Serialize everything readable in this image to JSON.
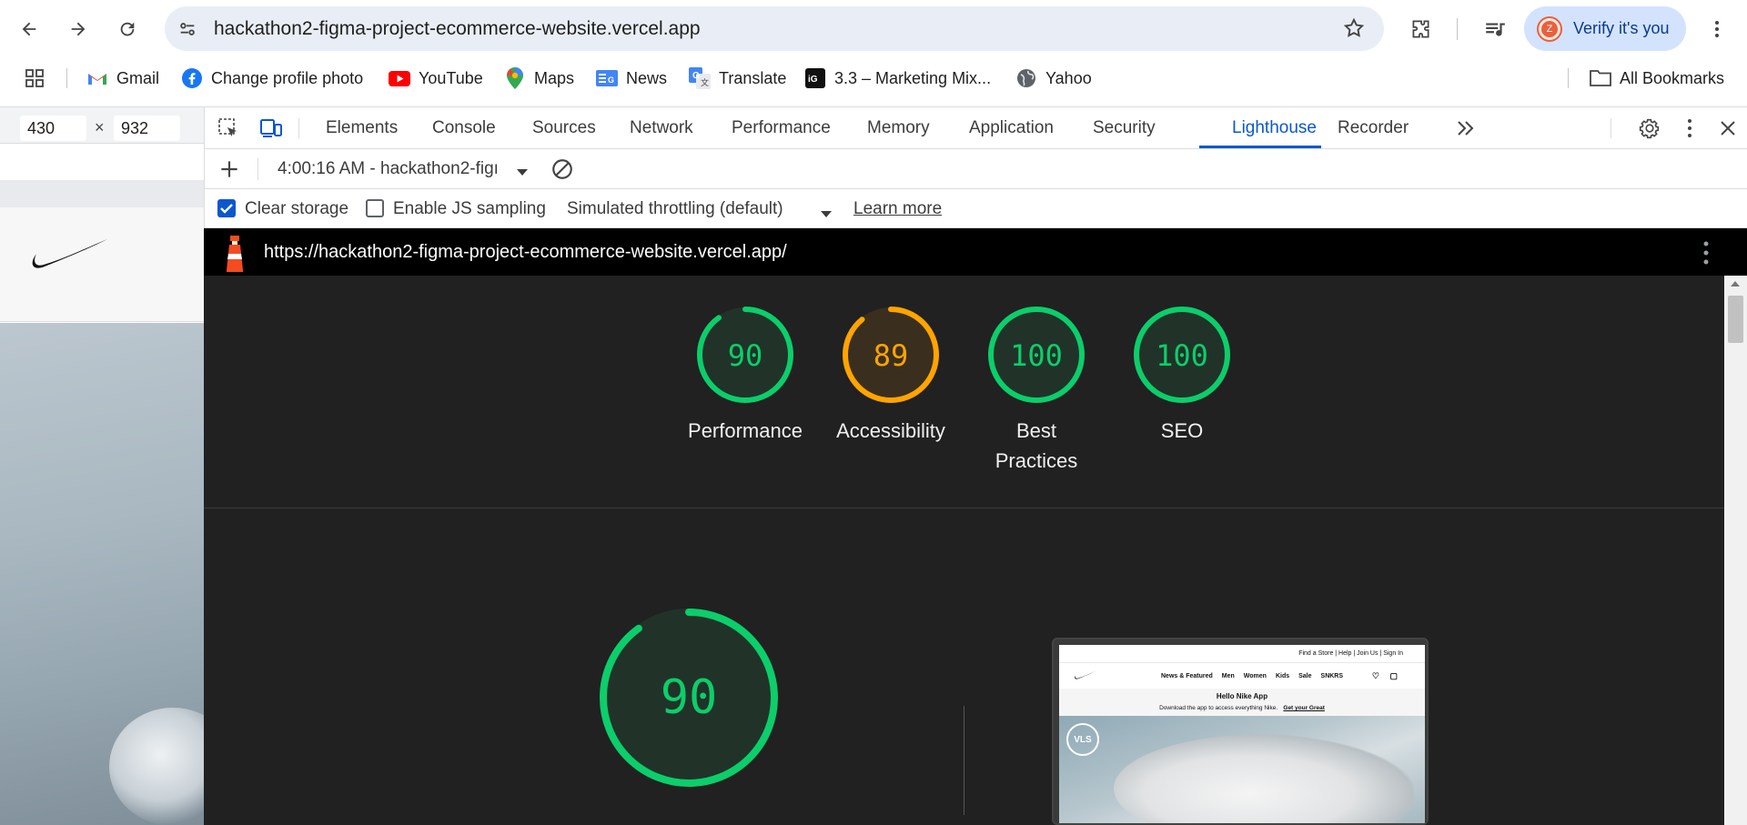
{
  "browser": {
    "url": "hackathon2-figma-project-ecommerce-website.vercel.app",
    "verify_label": "Verify it's you",
    "avatar_letter": "Z"
  },
  "bookmarks": [
    {
      "label": "Gmail",
      "icon": "gmail-icon"
    },
    {
      "label": "Change profile photo",
      "icon": "facebook-icon"
    },
    {
      "label": "YouTube",
      "icon": "youtube-icon"
    },
    {
      "label": "Maps",
      "icon": "maps-icon"
    },
    {
      "label": "News",
      "icon": "google-news-icon"
    },
    {
      "label": "Translate",
      "icon": "translate-icon"
    },
    {
      "label": "3.3 – Marketing Mix...",
      "icon": "ig-icon"
    },
    {
      "label": "Yahoo",
      "icon": "globe-icon"
    }
  ],
  "all_bookmarks": "All Bookmarks",
  "device": {
    "width": "430",
    "height": "932",
    "times": "×"
  },
  "devtools": {
    "tabs": [
      "Elements",
      "Console",
      "Sources",
      "Network",
      "Performance",
      "Memory",
      "Application",
      "Security",
      "Lighthouse",
      "Recorder"
    ],
    "active_tab": "Lighthouse"
  },
  "lighthouse": {
    "report_select": "4:00:16 AM - hackathon2-figı",
    "clear_storage": "Clear storage",
    "enable_js_sampling": "Enable JS sampling",
    "throttling": "Simulated throttling (default)",
    "learn_more": "Learn more",
    "report_url": "https://hackathon2-figma-project-ecommerce-website.vercel.app/",
    "scores": [
      {
        "label": "Performance",
        "value": 90,
        "color": "#0cce6b"
      },
      {
        "label": "Accessibility",
        "value": 89,
        "color": "#ffa400"
      },
      {
        "label_lines": [
          "Best",
          "Practices"
        ],
        "value": 100,
        "color": "#0cce6b"
      },
      {
        "label": "SEO",
        "value": 100,
        "color": "#0cce6b"
      }
    ],
    "big_score": 90
  },
  "thumbnail": {
    "utility_links": "Find a Store  |  Help  |  Join Us  |  Sign In",
    "nav": [
      "News & Featured",
      "Men",
      "Women",
      "Kids",
      "Sale",
      "SNKRS"
    ],
    "promo_title": "Hello Nike App",
    "promo_text": "Download the app to access everything Nike.",
    "promo_link": "Get your Great",
    "badge": "VLS"
  },
  "colors": {
    "pass": "#0cce6b",
    "average": "#ffa400",
    "accent": "#0b57d0"
  }
}
